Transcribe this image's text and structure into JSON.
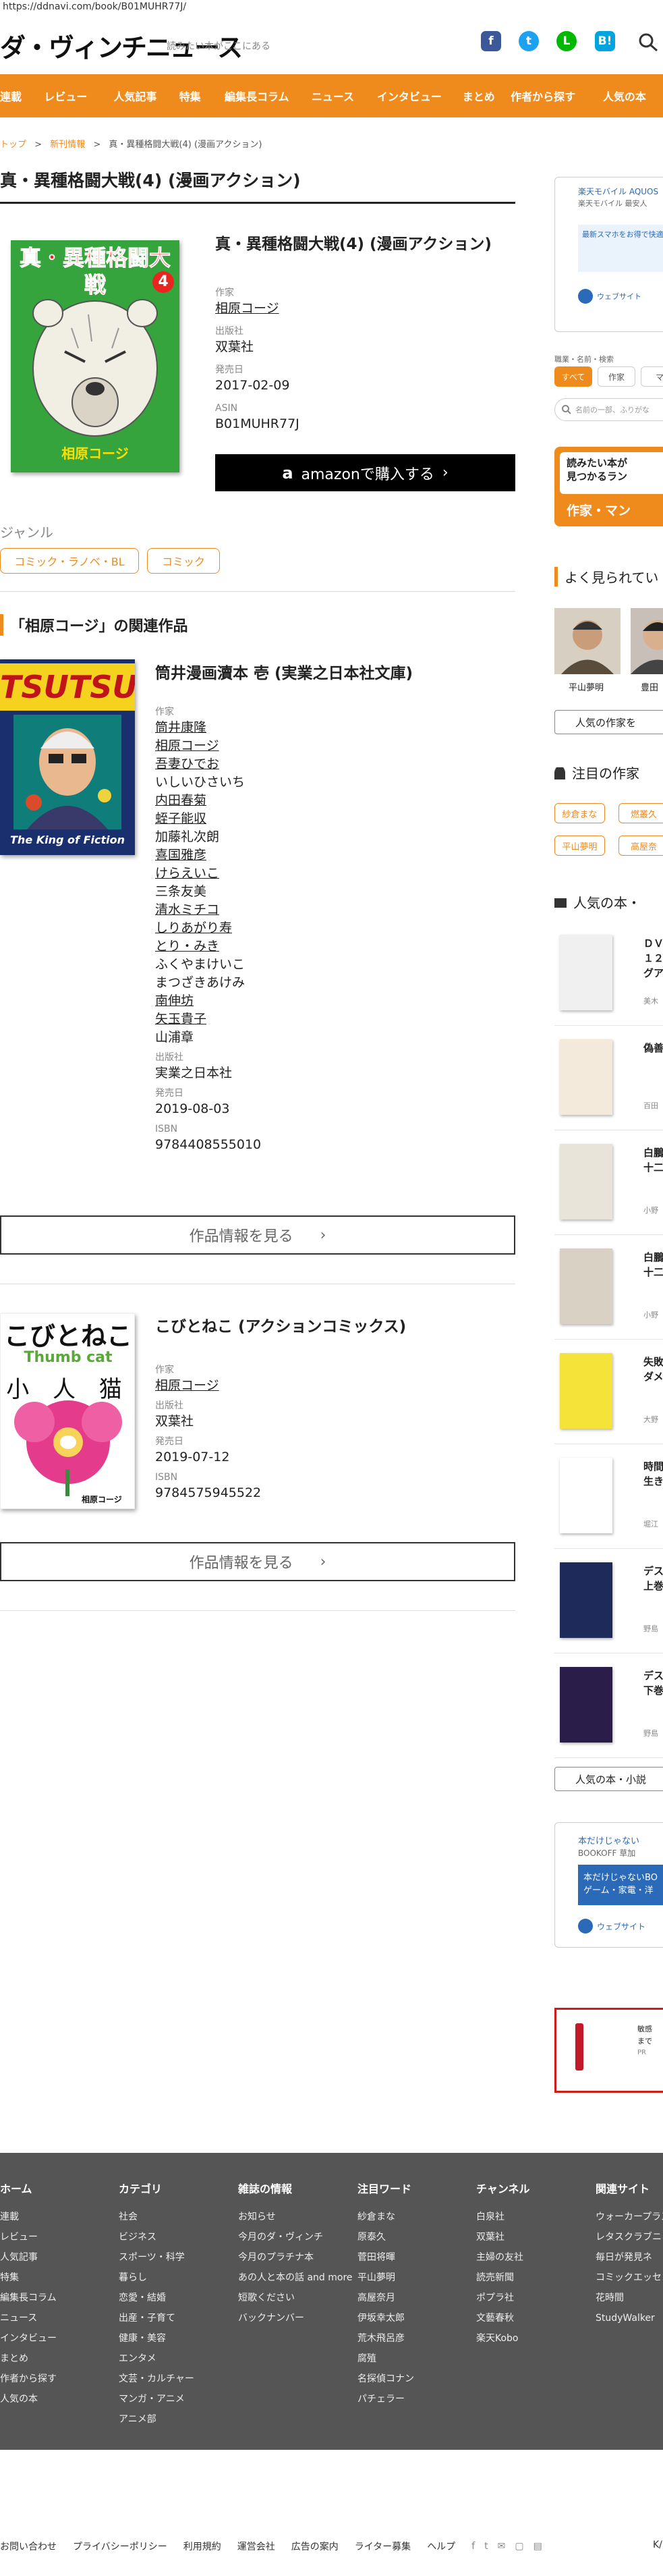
{
  "url": "https://ddnavi.com/book/B01MUHR77J/",
  "logo": "ダ・ヴィンチニュース",
  "tagline": "読みたい本がここにある",
  "social": [
    "f",
    "t",
    "L",
    "B!"
  ],
  "nav": [
    "連載",
    "レビュー",
    "人気記事",
    "特集",
    "編集長コラム",
    "ニュース",
    "インタビュー",
    "まとめ",
    "作者から探す",
    "人気の本"
  ],
  "breadcrumb": {
    "home": "トップ",
    "sep": ">",
    "section": "新刊情報",
    "current": "真・異種格闘大戦(4) (漫画アクション)"
  },
  "page_title": "真・異種格闘大戦(4) (漫画アクション)",
  "main_book": {
    "cover_title": "真・異種格闘大戦",
    "cover_num": "4",
    "cover_author": "相原コージ",
    "title": "真・異種格闘大戦(4) (漫画アクション)",
    "author_label": "作家",
    "author": "相原コージ",
    "publisher_label": "出版社",
    "publisher": "双葉社",
    "date_label": "発売日",
    "date": "2017-02-09",
    "asin_label": "ASIN",
    "asin": "B01MUHR77J",
    "buy_label": "amazonで購入する",
    "buy_icon": "a"
  },
  "genre": {
    "label": "ジャンル",
    "tags": [
      "コミック・ラノベ・BL",
      "コミック"
    ]
  },
  "related_heading": "「相原コージ」の関連作品",
  "related": [
    {
      "cover_title": "TSUTSUI",
      "cover_sub": "The King of Fiction",
      "title": "筒井漫画瀆本 壱 (実業之日本社文庫)",
      "author_label": "作家",
      "authors": [
        {
          "n": "筒井康隆",
          "u": true
        },
        {
          "n": "相原コージ",
          "u": true
        },
        {
          "n": "吾妻ひでお",
          "u": true
        },
        {
          "n": "いしいひさいち",
          "u": false
        },
        {
          "n": "内田春菊",
          "u": true
        },
        {
          "n": "蛭子能収",
          "u": true
        },
        {
          "n": "加藤礼次朗",
          "u": false
        },
        {
          "n": "喜国雅彦",
          "u": true
        },
        {
          "n": "けらえいこ",
          "u": true
        },
        {
          "n": "三条友美",
          "u": false
        },
        {
          "n": "清水ミチコ",
          "u": true
        },
        {
          "n": "しりあがり寿",
          "u": true
        },
        {
          "n": "とり・みき",
          "u": true
        },
        {
          "n": "ふくやまけいこ",
          "u": false
        },
        {
          "n": "まつざきあけみ",
          "u": false
        },
        {
          "n": "南伸坊",
          "u": true
        },
        {
          "n": "矢玉貴子",
          "u": true
        },
        {
          "n": "山浦章",
          "u": false
        }
      ],
      "publisher_label": "出版社",
      "publisher": "実業之日本社",
      "date_label": "発売日",
      "date": "2019-08-03",
      "isbn_label": "ISBN",
      "isbn": "9784408555010",
      "more": "作品情報を見る"
    },
    {
      "cover_title": "こびとねこ",
      "cover_sub": "Thumb cat",
      "cover_chars": "小 人 猫",
      "cover_author": "相原コージ",
      "title": "こびとねこ (アクションコミックス)",
      "author_label": "作家",
      "author": "相原コージ",
      "publisher_label": "出版社",
      "publisher": "双葉社",
      "date_label": "発売日",
      "date": "2019-07-12",
      "isbn_label": "ISBN",
      "isbn": "9784575945522",
      "more": "作品情報を見る"
    }
  ],
  "sidebar": {
    "ad1_title": "楽天モバイル AQUOS",
    "ad1_sub": "楽天モバイル 最安人",
    "ad1_body": "最新スマホをお得で快適",
    "ad1_link": "ウェブサイト",
    "search_label": "職業・名前・検索",
    "search_tabs": [
      "すべて",
      "作家",
      "マ"
    ],
    "search_placeholder": "名前の一部、ふりがな",
    "banner_line1": "読みたい本が",
    "banner_line2": "見つかるラン",
    "banner_cta": "作家・マン",
    "popular_heading": "よく見られてい",
    "popular_people": [
      "平山夢明",
      "豊田"
    ],
    "popular_more": "人気の作家を",
    "attention_heading": "注目の作家",
    "attention_tags": [
      "紗倉まな",
      "燃叢久",
      "平山夢明",
      "高屋奈"
    ],
    "books_heading": "人気の本・",
    "books": [
      {
        "t1": "ＤＶ",
        "t2": "１２",
        "t3": "グア",
        "a": "美木"
      },
      {
        "t1": "偽善",
        "t2": "",
        "t3": "",
        "a": "百田"
      },
      {
        "t1": "白鵬",
        "t2": "十二",
        "t3": "",
        "a": "小野"
      },
      {
        "t1": "白鵬",
        "t2": "十二",
        "t3": "",
        "a": "小野"
      },
      {
        "t1": "失敗",
        "t2": "ダメ",
        "t3": "",
        "a": "大野"
      },
      {
        "t1": "時間",
        "t2": "生き",
        "t3": "",
        "a": "堀江"
      },
      {
        "t1": "デス",
        "t2": "上巻",
        "t3": "",
        "a": "野島"
      },
      {
        "t1": "デス",
        "t2": "下巻",
        "t3": "",
        "a": "野島"
      }
    ],
    "books_more": "人気の本・小説",
    "ad2_title": "本だけじゃない",
    "ad2_sub": "BOOKOFF 草加",
    "ad2_body1": "本だけじゃないBO",
    "ad2_body2": "ゲーム・家電・洋",
    "ad2_link": "ウェブサイト",
    "ad3_text1": "敏感",
    "ad3_text2": "まで",
    "ad3_text3": "PR"
  },
  "footer": {
    "cols": [
      {
        "h": "ホーム",
        "items": [
          "連載",
          "レビュー",
          "人気記事",
          "特集",
          "編集長コラム",
          "ニュース",
          "インタビュー",
          "まとめ",
          "作者から探す",
          "人気の本"
        ]
      },
      {
        "h": "カテゴリ",
        "items": [
          "社会",
          "ビジネス",
          "スポーツ・科学",
          "暮らし",
          "恋愛・結婚",
          "出産・子育て",
          "健康・美容",
          "エンタメ",
          "文芸・カルチャー",
          "マンガ・アニメ",
          "アニメ部"
        ]
      },
      {
        "h": "雑誌の情報",
        "items": [
          "お知らせ",
          "今月のダ・ヴィンチ",
          "今月のプラチナ本",
          "あの人と本の話 and more",
          "短歌ください",
          "バックナンバー"
        ]
      },
      {
        "h": "注目ワード",
        "items": [
          "紗倉まな",
          "原泰久",
          "菅田将暉",
          "平山夢明",
          "高屋奈月",
          "伊坂幸太郎",
          "荒木飛呂彦",
          "腐殖",
          "名探偵コナン",
          "パチェラー"
        ]
      },
      {
        "h": "チャンネル",
        "items": [
          "白泉社",
          "双葉社",
          "主婦の友社",
          "読売新聞",
          "ポプラ社",
          "文藝春秋",
          "楽天Kobo"
        ]
      },
      {
        "h": "関連サイト",
        "items": [
          "ウォーカープラス",
          "レタスクラブニ",
          "毎日が発見ネ",
          "コミックエッセ",
          "花時間",
          "StudyWalker"
        ]
      }
    ]
  },
  "bottom_links": [
    "お問い合わせ",
    "プライバシーポリシー",
    "利用規約",
    "運営会社",
    "広告の案内",
    "ライター募集",
    "ヘルプ"
  ],
  "bottom_icons": [
    "f",
    "t",
    "✉",
    "▢",
    "▤"
  ],
  "bottom_right": "K/"
}
